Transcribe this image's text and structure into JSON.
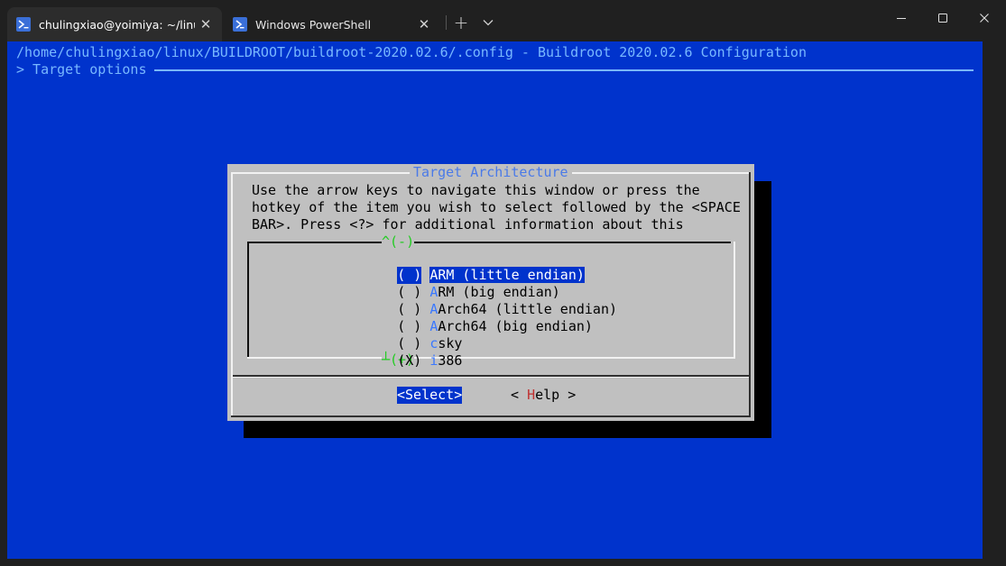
{
  "tabs": [
    {
      "label": "chulingxiao@yoimiya: ~/linux",
      "icon": "terminal-icon",
      "active": true
    },
    {
      "label": "Windows PowerShell",
      "icon": "powershell-icon",
      "active": false
    }
  ],
  "toolbar": {
    "new_tab_glyph": "+",
    "dropdown_glyph": "⌄"
  },
  "window_controls": {
    "minimize": "—",
    "maximize": "☐",
    "close": "✕"
  },
  "terminal": {
    "path_line": "/home/chulingxiao/linux/BUILDROOT/buildroot-2020.02.6/.config - Buildroot 2020.02.6 Configuration",
    "breadcrumb": "> Target options"
  },
  "dialog": {
    "title": "Target Architecture",
    "help_lines": [
      "Use the arrow keys to navigate this window or press the",
      "hotkey of the item you wish to select followed by the <SPACE",
      "BAR>. Press <?> for additional information about this"
    ],
    "scroll_up": "^(-)",
    "scroll_down": "┴(+)",
    "items": [
      {
        "radio": "( )",
        "hotkey": "A",
        "rest": "RM (little endian)",
        "selected_cursor": true
      },
      {
        "radio": "( )",
        "hotkey": "A",
        "rest": "RM (big endian)"
      },
      {
        "radio": "( )",
        "hotkey": "A",
        "rest": "Arch64 (little endian)"
      },
      {
        "radio": "( )",
        "hotkey": "A",
        "rest": "Arch64 (big endian)"
      },
      {
        "radio": "( )",
        "hotkey": "c",
        "rest": "sky"
      },
      {
        "radio": "(X)",
        "hotkey": "i",
        "rest": "386"
      }
    ],
    "buttons": {
      "select": "<Select>",
      "help_prefix": "< ",
      "help_hotkey": "H",
      "help_rest": "elp >"
    }
  },
  "colors": {
    "terminal_bg": "#0033cc",
    "dialog_bg": "#c0c0c0",
    "title_fg": "#4a7ae8",
    "hotkey_fg": "#3a78ff",
    "scroll_fg": "#22cc22",
    "help_hotkey_fg": "#c03030"
  }
}
